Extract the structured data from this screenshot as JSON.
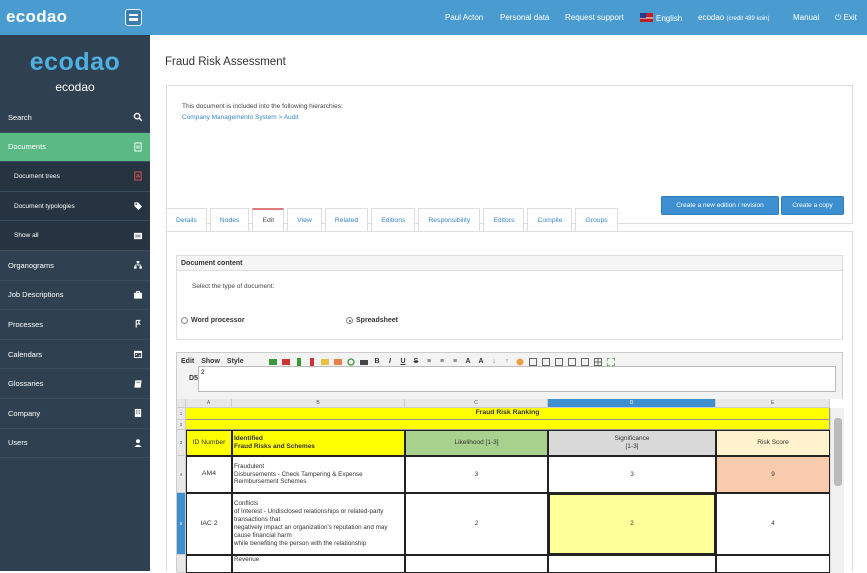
{
  "topbar": {
    "logo": "ecodao",
    "user": "Paul Acton",
    "personal_data": "Personal data",
    "support": "Request support",
    "language": "English",
    "account": "ecodao",
    "credit": "(credit 489 koin)",
    "manual": "Manual",
    "exit": "Exit"
  },
  "sidebar": {
    "brand": "ecodao",
    "user": "ecodao",
    "items": [
      {
        "label": "Search",
        "icon": "search-icon"
      },
      {
        "label": "Documents",
        "icon": "document-icon"
      },
      {
        "label": "Document trees",
        "icon": "pdf-icon"
      },
      {
        "label": "Document typologies",
        "icon": "tag-icon"
      },
      {
        "label": "Show all",
        "icon": "list-icon"
      },
      {
        "label": "Organograms",
        "icon": "sitemap-icon"
      },
      {
        "label": "Job Descriptions",
        "icon": "briefcase-icon"
      },
      {
        "label": "Processes",
        "icon": "process-icon"
      },
      {
        "label": "Calendars",
        "icon": "calendar-icon"
      },
      {
        "label": "Glossaries",
        "icon": "book-icon"
      },
      {
        "label": "Company",
        "icon": "building-icon"
      },
      {
        "label": "Users",
        "icon": "user-icon"
      }
    ]
  },
  "page": {
    "title": "Fraud Risk Assessment",
    "hierarchy_text": "This document is included into the following hierarchies:",
    "hierarchy_link": "Company Managemento System > Audit",
    "new_edition_btn": "Create a new edition / revision",
    "copy_btn": "Create a copy"
  },
  "tabs": [
    "Details",
    "Nodes",
    "Edit",
    "View",
    "Related",
    "Editions",
    "Responsibility",
    "Editors",
    "Compile",
    "Groups"
  ],
  "active_tab": "Edit",
  "content": {
    "header": "Document content",
    "type_label": "Select the type of document:",
    "word": "Word processor",
    "spreadsheet": "Spreadsheet",
    "selected": "Spreadsheet"
  },
  "sheet": {
    "menu": [
      "Edit",
      "Show",
      "Style"
    ],
    "cell_ref": "D5",
    "formula": "2",
    "columns": [
      "A",
      "B",
      "C",
      "D",
      "E"
    ],
    "rows": [
      "1",
      "2",
      "3",
      "4",
      "5"
    ],
    "title": "Fraud Risk Ranking",
    "headers": [
      "ID Number",
      "Identified\n  Fraud Risks and Schemes",
      "Likelihood [1-3]",
      "Significance\n[1-3]",
      "Risk Score"
    ],
    "data": [
      [
        "AM4",
        "Fraudulent\n  Disbursements - Check Tampering & Expense Reimbursement Schemes",
        "3",
        "3",
        "9"
      ],
      [
        "IAC 2",
        "Conflicts\n  of Interest - Undisclosed relationships or related-party transactions that\n  negatively impact an organization's reputation and may cause financial harm\n  while benefiting the person with the relationship",
        "2",
        "2",
        "4"
      ],
      [
        "",
        "Revenue",
        "",
        "",
        ""
      ]
    ]
  },
  "colors": {
    "topbar": "#4a9cd0",
    "sidebar": "#2f4050",
    "active": "#5bb985",
    "yellow": "#ffff00",
    "likelihood": "#a9d18e",
    "significance": "#d9d9d9",
    "riskscore": "#fff2cc",
    "highrisk": "#f8cbad",
    "selected_cell": "#ffff99"
  }
}
